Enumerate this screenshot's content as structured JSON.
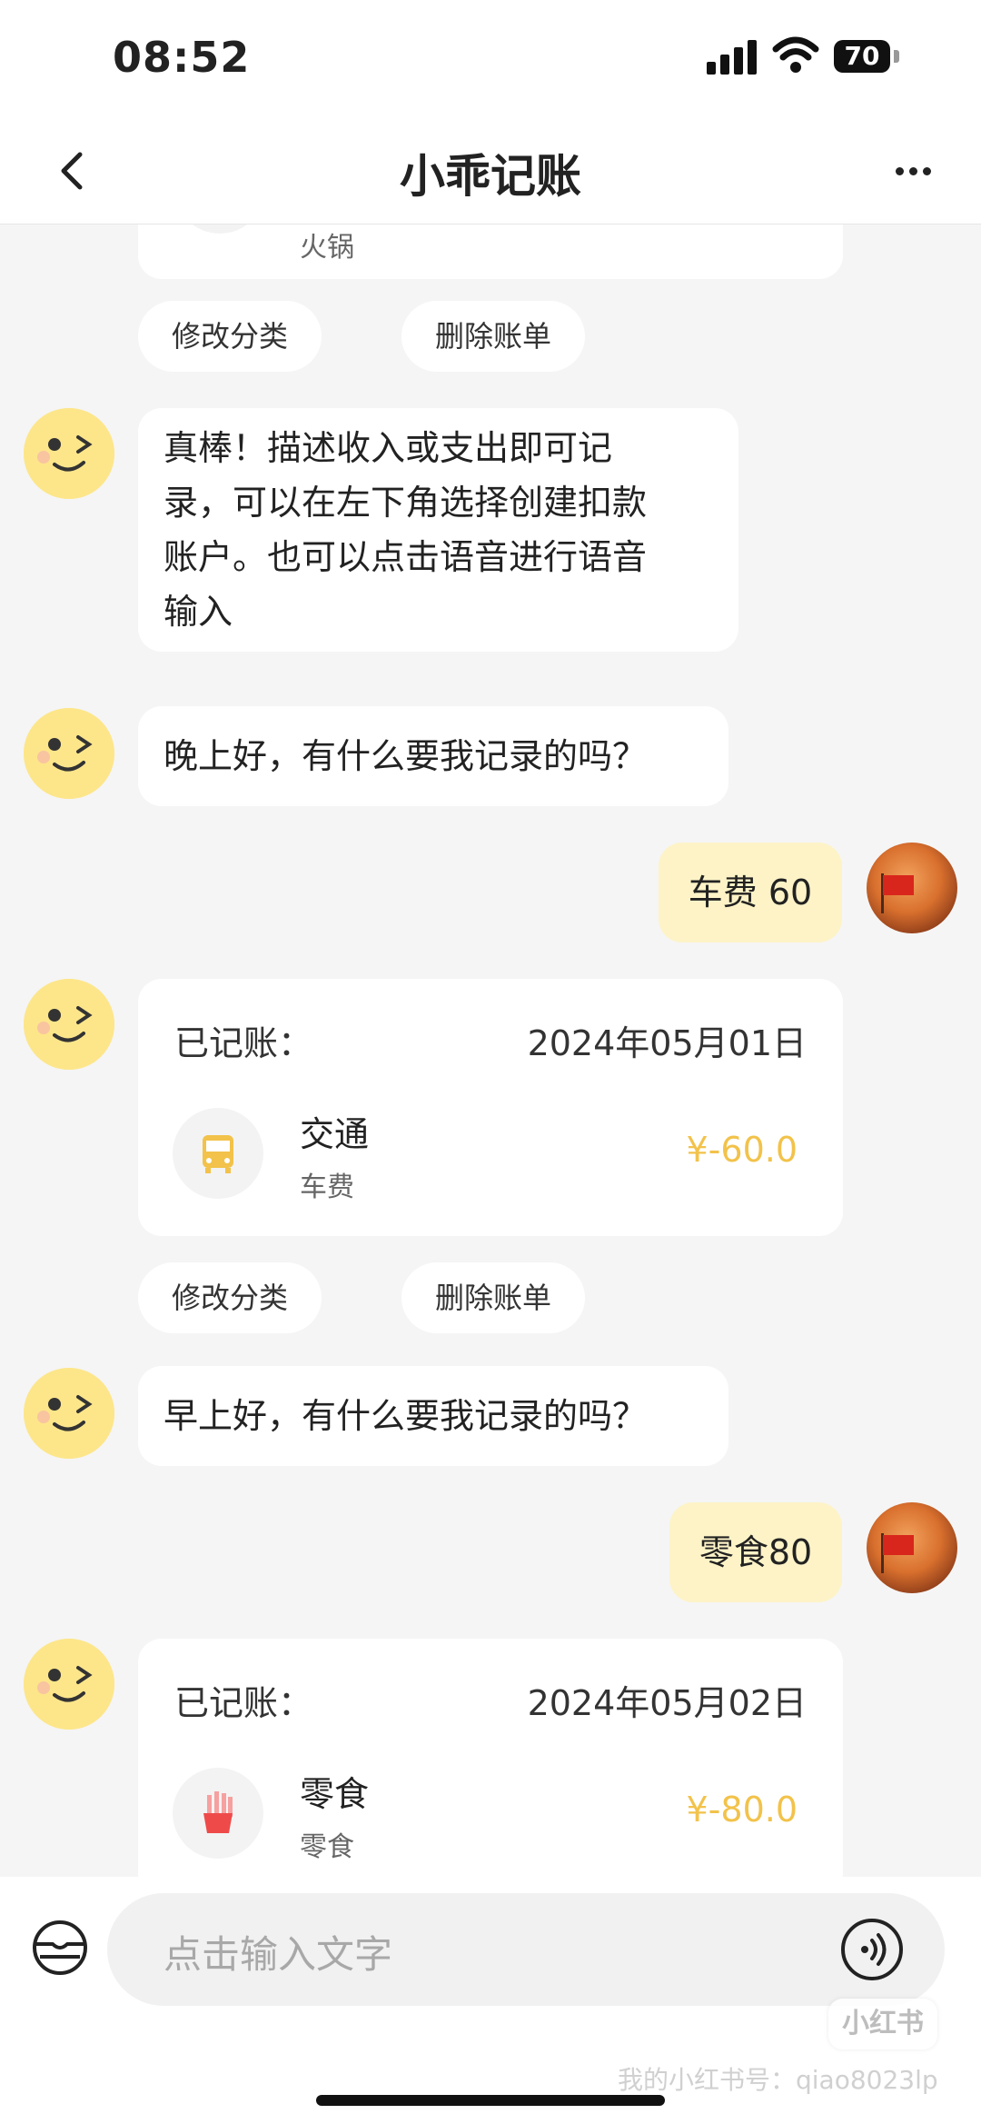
{
  "status": {
    "time": "08:52",
    "battery": "70"
  },
  "nav": {
    "title": "小乖记账"
  },
  "chat": {
    "prev_sub": "火锅",
    "chips": {
      "edit": "修改分类",
      "delete": "删除账单"
    },
    "bot_intro": [
      "真棒！描述收入或支出即可记",
      "录，可以在左下角选择创建扣款",
      "账户。也可以点击语音进行语音",
      "输入"
    ],
    "greet_evening": "晚上好，有什么要我记录的吗？",
    "user_msg1": "车费 60",
    "record1": {
      "title": "已记账：",
      "date": "2024年05月01日",
      "category": "交通",
      "sub": "车费",
      "amount": "¥-60.0"
    },
    "greet_morning": "早上好，有什么要我记录的吗？",
    "user_msg2": "零食80",
    "record2": {
      "title": "已记账：",
      "date": "2024年05月02日",
      "category": "零食",
      "sub": "零食",
      "amount": "¥-80.0"
    }
  },
  "input": {
    "placeholder": "点击输入文字"
  },
  "watermark": {
    "badge": "小红书",
    "text": "我的小红书号：qiao8023lp"
  },
  "colors": {
    "accent": "#f2c24a",
    "user_bubble": "#fdf3c7",
    "bot_avatar": "#fde68a"
  }
}
